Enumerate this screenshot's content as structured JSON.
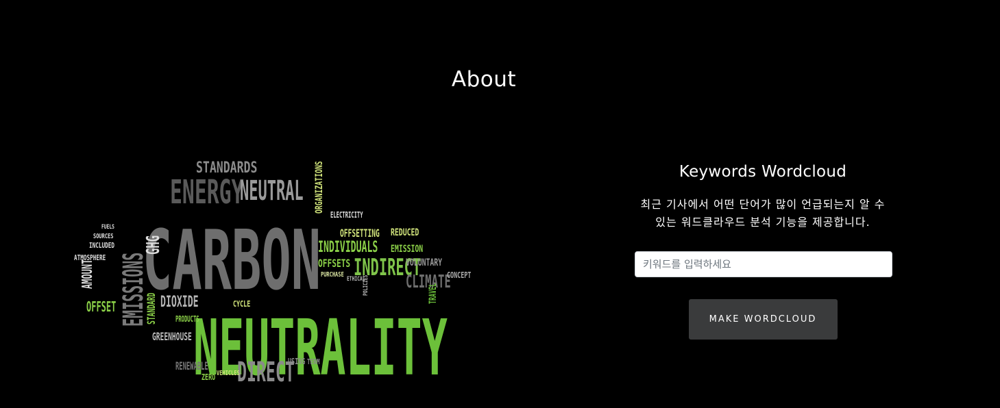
{
  "about": {
    "title": "About"
  },
  "wordcloud_image": {
    "icon": "carbon-neutrality-wordcloud",
    "words": [
      {
        "text": "STANDARDS",
        "color": "#8c8c8c"
      },
      {
        "text": "ENERGY",
        "color": "#5a5a5a"
      },
      {
        "text": "NEUTRAL",
        "color": "#9a9a9a"
      },
      {
        "text": "CARBON",
        "color": "#6e6e6e"
      },
      {
        "text": "NEUTRALITY",
        "color": "#6cc03a"
      },
      {
        "text": "EMISSIONS",
        "color": "#7a7a7a"
      },
      {
        "text": "INDIRECT",
        "color": "#7fc44a"
      },
      {
        "text": "INDIVIDUALS",
        "color": "#8bd048"
      },
      {
        "text": "OFFSETTING",
        "color": "#cfe27a"
      },
      {
        "text": "OFFSETS",
        "color": "#8bd048"
      },
      {
        "text": "PURCHASE",
        "color": "#d8e2a0"
      },
      {
        "text": "CLIMATE",
        "color": "#6e6e6e"
      },
      {
        "text": "VOLUNTARY",
        "color": "#9a9a9a"
      },
      {
        "text": "CONCEPT",
        "color": "#aaaaaa"
      },
      {
        "text": "DIRECT",
        "color": "#8a8a8a"
      },
      {
        "text": "DIOXIDE",
        "color": "#b5b5b5"
      },
      {
        "text": "GREENHOUSE",
        "color": "#bdbdbd"
      },
      {
        "text": "OFFSET",
        "color": "#8bd048"
      },
      {
        "text": "STANDARD",
        "color": "#8bd048"
      },
      {
        "text": "RENEWABLE",
        "color": "#777777"
      },
      {
        "text": "ZERO",
        "color": "#8bd048"
      },
      {
        "text": "TRAVEL",
        "color": "#6cc03a"
      },
      {
        "text": "REDUCED",
        "color": "#cfe27a"
      },
      {
        "text": "EMISSION",
        "color": "#8bd048"
      },
      {
        "text": "ORGANIZATIONS",
        "color": "#cfe27a"
      },
      {
        "text": "ELECTRICITY",
        "color": "#dddddd"
      },
      {
        "text": "INCLUDED",
        "color": "#dddddd"
      },
      {
        "text": "ATMOSPHERE",
        "color": "#dddddd"
      },
      {
        "text": "SOURCES",
        "color": "#dddddd"
      },
      {
        "text": "FUELS",
        "color": "#dddddd"
      },
      {
        "text": "AMOUNT",
        "color": "#dddddd"
      },
      {
        "text": "USING",
        "color": "#8a8a8a"
      },
      {
        "text": "VEHICLES",
        "color": "#cfe27a"
      },
      {
        "text": "CYCLE",
        "color": "#cfe27a"
      },
      {
        "text": "ETHICAL",
        "color": "#bbbbbb"
      },
      {
        "text": "POLICIES",
        "color": "#bbbbbb"
      },
      {
        "text": "PRODUCTS",
        "color": "#8bd048"
      },
      {
        "text": "GHG",
        "color": "#dddddd"
      },
      {
        "text": "TERM",
        "color": "#8a8a8a"
      }
    ]
  },
  "panel": {
    "title": "Keywords Wordcloud",
    "description": "최근 기사에서 어떤 단어가 많이 언급되는지 알 수 있는 워드클라우드 분석 기능을 제공합니다.",
    "input_placeholder": "키워드를 입력하세요",
    "input_value": "",
    "button_label": "MAKE WORDCLOUD"
  },
  "colors": {
    "background": "#000000",
    "text": "#ffffff",
    "button_bg": "#3a3b3c",
    "accent_green": "#6cc03a"
  }
}
